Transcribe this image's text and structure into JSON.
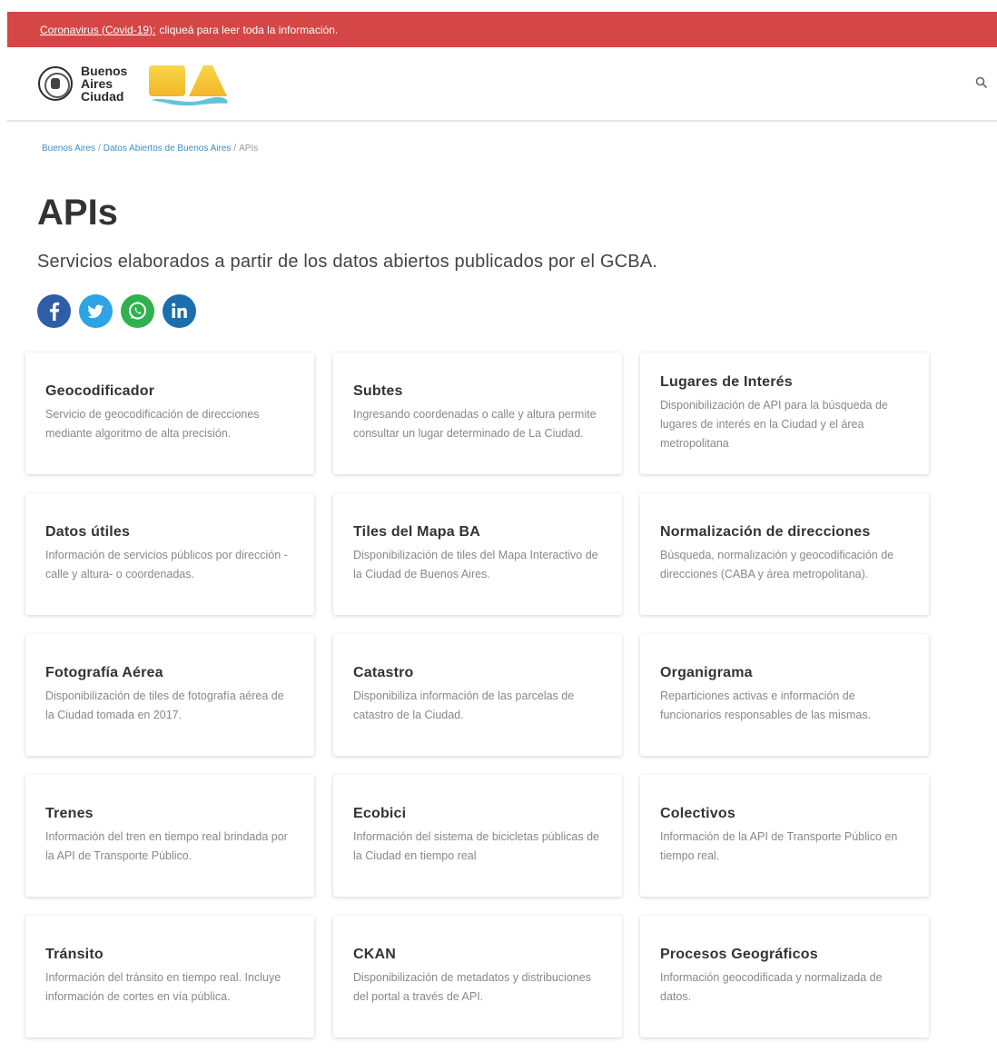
{
  "banner": {
    "link_text": "Coronavirus (Covid-19):",
    "rest_text": "cliqueá para leer toda la información."
  },
  "header": {
    "logo_text": [
      "Buenos",
      "Aires",
      "Ciudad"
    ],
    "colors": {
      "banner": "#d54646",
      "link": "#3d8fc4",
      "ba_yellow": "#f5c12e",
      "ba_cyan": "#64c3d9"
    }
  },
  "breadcrumb": {
    "items": [
      "Buenos Aires",
      "Datos Abiertos de Buenos Aires"
    ],
    "current": "APIs"
  },
  "page": {
    "title": "APIs",
    "subtitle": "Servicios elaborados a partir de los datos abiertos publicados por el GCBA."
  },
  "share": [
    {
      "icon": "facebook-icon",
      "glyph": "f",
      "color": "#2f5da8"
    },
    {
      "icon": "twitter-icon",
      "glyph": "t",
      "color": "#2ea3e6"
    },
    {
      "icon": "whatsapp-icon",
      "glyph": "w",
      "color": "#2fb14f"
    },
    {
      "icon": "linkedin-icon",
      "glyph": "in",
      "color": "#1b6fae"
    }
  ],
  "cards": [
    {
      "title": "Geocodificador",
      "desc": "Servicio de geocodificación de direcciones mediante algoritmo de alta precisión."
    },
    {
      "title": "Subtes",
      "desc": "Ingresando coordenadas o calle y altura permite consultar un lugar determinado de La Ciudad."
    },
    {
      "title": "Lugares de Interés",
      "desc": "Disponibilización de API para la búsqueda de lugares de interés en la Ciudad y el área metropolitana"
    },
    {
      "title": "Datos útiles",
      "desc": "Información de servicios públicos por dirección -calle y altura- o coordenadas."
    },
    {
      "title": "Tiles del Mapa BA",
      "desc": "Disponibilización de tiles del Mapa Interactivo de la Ciudad de Buenos Aires."
    },
    {
      "title": "Normalización de direcciones",
      "desc": "Búsqueda, normalización y geocodificación de direcciones (CABA y área metropolitana)."
    },
    {
      "title": "Fotografía Aérea",
      "desc": "Disponibilización de tiles de fotografía aérea de la Ciudad tomada en 2017."
    },
    {
      "title": "Catastro",
      "desc": "Disponibiliza información de las parcelas de catastro de la Ciudad."
    },
    {
      "title": "Organigrama",
      "desc": "Reparticiones activas e información de funcionarios responsables de las mismas."
    },
    {
      "title": "Trenes",
      "desc": "Información del tren en tiempo real brindada por la API de Transporte Público."
    },
    {
      "title": "Ecobici",
      "desc": "Información del sistema de bicicletas públicas de la Ciudad en tiempo real"
    },
    {
      "title": "Colectivos",
      "desc": "Información de la API de Transporte Público en tiempo real."
    },
    {
      "title": "Tránsito",
      "desc": "Información del tránsito en tiempo real. Incluye información de cortes en vía pública."
    },
    {
      "title": "CKAN",
      "desc": "Disponibilización de metadatos y distribuciones del portal a través de API."
    },
    {
      "title": "Procesos Geográficos",
      "desc": "Información geocodificada y normalizada de datos."
    }
  ]
}
